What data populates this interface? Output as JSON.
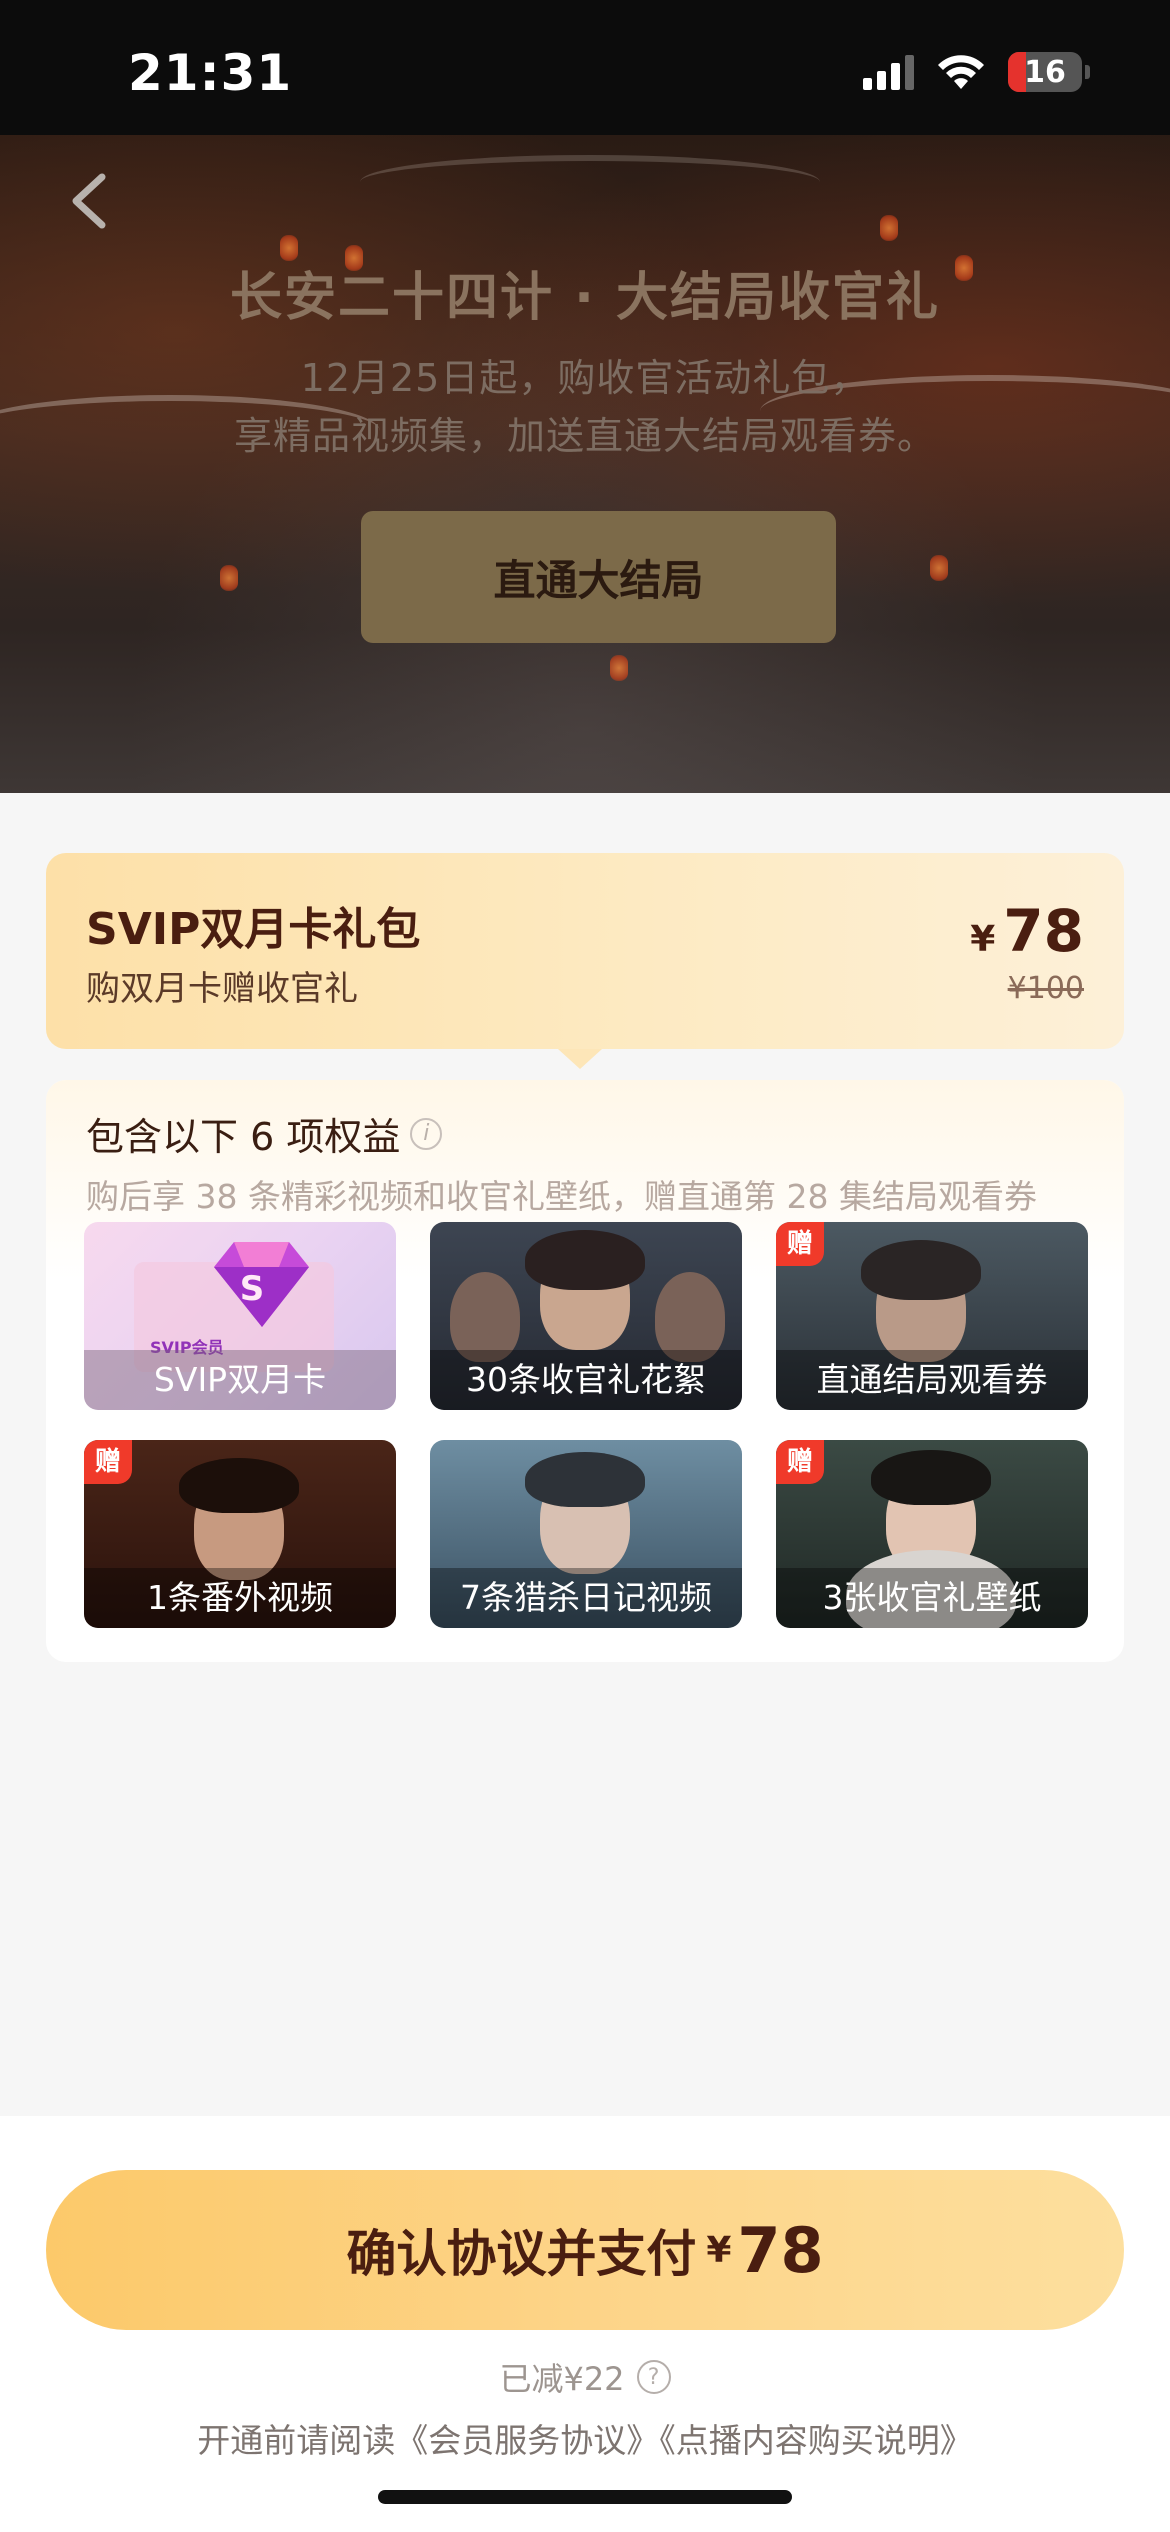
{
  "status_bar": {
    "time": "21:31",
    "battery": "16",
    "icons": [
      "signal-icon",
      "wifi-icon",
      "battery-icon"
    ]
  },
  "hero": {
    "back_icon": "chevron-left-icon",
    "title": "长安二十四计 · 大结局收官礼",
    "subtitle_line1": "12月25日起，购收官活动礼包，",
    "subtitle_line2": "享精品视频集，加送直通大结局观看券。",
    "cta_label": "直通大结局"
  },
  "package": {
    "title": "SVIP双月卡礼包",
    "subtitle": "购双月卡赠收官礼",
    "currency": "¥",
    "price": "78",
    "original_price": "¥100"
  },
  "benefits": {
    "title": "包含以下 6 项权益",
    "description": "购后享 38 条精彩视频和收官礼壁纸，赠直通第 28 集结局观看券",
    "items": [
      {
        "label": "SVIP双月卡",
        "badge": "",
        "logo_text": "SVIP会员"
      },
      {
        "label": "30条收官礼花絮",
        "badge": ""
      },
      {
        "label": "直通结局观看券",
        "badge": "赠"
      },
      {
        "label": "1条番外视频",
        "badge": "赠"
      },
      {
        "label": "7条猎杀日记视频",
        "badge": ""
      },
      {
        "label": "3张收官礼壁纸",
        "badge": "赠"
      }
    ]
  },
  "footer": {
    "pay_label": "确认协议并支付",
    "pay_currency": "¥",
    "pay_amount": "78",
    "discount": "已减¥22",
    "agreement": "开通前请阅读《会员服务协议》《点播内容购买说明》"
  },
  "colors": {
    "accent_gold": "#fcc96a",
    "text_brown": "#4a1e10",
    "badge_red": "#f03a2a"
  }
}
